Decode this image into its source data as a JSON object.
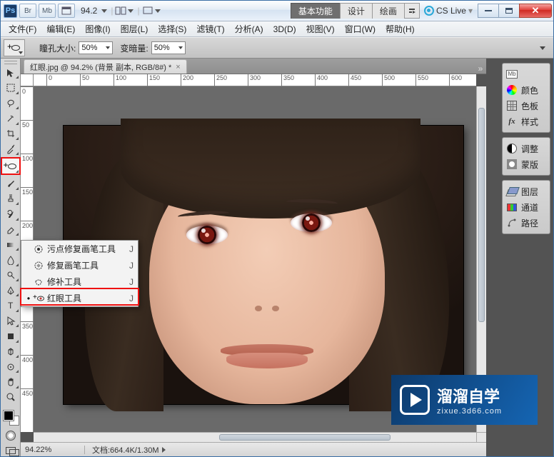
{
  "title": {
    "zoom_value": "94.2",
    "workspace_tabs": [
      "基本功能",
      "设计",
      "绘画"
    ],
    "active_ws": 0,
    "cslive": "CS Live"
  },
  "menus": [
    "文件(F)",
    "编辑(E)",
    "图像(I)",
    "图层(L)",
    "选择(S)",
    "滤镜(T)",
    "分析(A)",
    "3D(D)",
    "视图(V)",
    "窗口(W)",
    "帮助(H)"
  ],
  "options": {
    "pupil_label": "瞳孔大小:",
    "pupil_value": "50%",
    "darken_label": "变暗量:",
    "darken_value": "50%"
  },
  "document": {
    "tab_label": "红眼.jpg @ 94.2% (背景 副本, RGB/8#) *",
    "ruler_marks": [
      "0",
      "50",
      "100",
      "150",
      "200",
      "250",
      "300",
      "350",
      "400",
      "450",
      "500",
      "550",
      "600"
    ]
  },
  "flyout": {
    "items": [
      {
        "label": "污点修复画笔工具",
        "key": "J",
        "selected": false,
        "icon": "spot-heal"
      },
      {
        "label": "修复画笔工具",
        "key": "J",
        "selected": false,
        "icon": "heal"
      },
      {
        "label": "修补工具",
        "key": "J",
        "selected": false,
        "icon": "patch"
      },
      {
        "label": "红眼工具",
        "key": "J",
        "selected": true,
        "icon": "redeye"
      }
    ]
  },
  "panels": {
    "g1": [
      {
        "icon": "mb",
        "label": ""
      },
      {
        "icon": "colorwheel",
        "label": "颜色"
      },
      {
        "icon": "grid",
        "label": "色板"
      },
      {
        "icon": "fx",
        "label": "样式"
      }
    ],
    "g2": [
      {
        "icon": "bw",
        "label": "调整"
      },
      {
        "icon": "mask",
        "label": "蒙版"
      }
    ],
    "g3": [
      {
        "icon": "layers",
        "label": "图层"
      },
      {
        "icon": "chan",
        "label": "通道"
      },
      {
        "icon": "path",
        "label": "路径"
      }
    ]
  },
  "status": {
    "zoom": "94.22%",
    "doc": "文档:664.4K/1.30M"
  },
  "watermark": {
    "line1": "溜溜自学",
    "line2": "zixue.3d66.com"
  }
}
